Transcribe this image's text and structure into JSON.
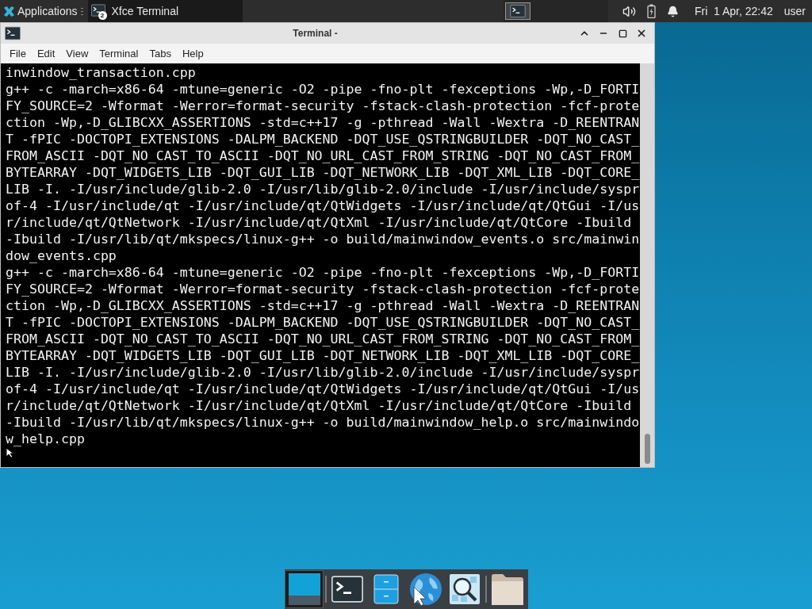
{
  "top_panel": {
    "applications_label": "Applications",
    "tasks": [
      {
        "title": "Xfce Terminal",
        "selected": true,
        "badge": "2"
      }
    ],
    "clock": "Fri  1 Apr, 22:42",
    "user": "user"
  },
  "window": {
    "title": "Terminal -",
    "menu": [
      "File",
      "Edit",
      "View",
      "Terminal",
      "Tabs",
      "Help"
    ],
    "lines": [
      "inwindow_transaction.cpp",
      "g++ -c -march=x86-64 -mtune=generic -O2 -pipe -fno-plt -fexceptions -Wp,-D_FORTI",
      "FY_SOURCE=2 -Wformat -Werror=format-security -fstack-clash-protection -fcf-prote",
      "ction -Wp,-D_GLIBCXX_ASSERTIONS -std=c++17 -g -pthread -Wall -Wextra -D_REENTRAN",
      "T -fPIC -DOCTOPI_EXTENSIONS -DALPM_BACKEND -DQT_USE_QSTRINGBUILDER -DQT_NO_CAST_",
      "FROM_ASCII -DQT_NO_CAST_TO_ASCII -DQT_NO_URL_CAST_FROM_STRING -DQT_NO_CAST_FROM_",
      "BYTEARRAY -DQT_WIDGETS_LIB -DQT_GUI_LIB -DQT_NETWORK_LIB -DQT_XML_LIB -DQT_CORE_",
      "LIB -I. -I/usr/include/glib-2.0 -I/usr/lib/glib-2.0/include -I/usr/include/syspr",
      "of-4 -I/usr/include/qt -I/usr/include/qt/QtWidgets -I/usr/include/qt/QtGui -I/us",
      "r/include/qt/QtNetwork -I/usr/include/qt/QtXml -I/usr/include/qt/QtCore -Ibuild",
      "-Ibuild -I/usr/lib/qt/mkspecs/linux-g++ -o build/mainwindow_events.o src/mainwin",
      "dow_events.cpp",
      "g++ -c -march=x86-64 -mtune=generic -O2 -pipe -fno-plt -fexceptions -Wp,-D_FORTI",
      "FY_SOURCE=2 -Wformat -Werror=format-security -fstack-clash-protection -fcf-prote",
      "ction -Wp,-D_GLIBCXX_ASSERTIONS -std=c++17 -g -pthread -Wall -Wextra -D_REENTRAN",
      "T -fPIC -DOCTOPI_EXTENSIONS -DALPM_BACKEND -DQT_USE_QSTRINGBUILDER -DQT_NO_CAST_",
      "FROM_ASCII -DQT_NO_CAST_TO_ASCII -DQT_NO_URL_CAST_FROM_STRING -DQT_NO_CAST_FROM_",
      "BYTEARRAY -DQT_WIDGETS_LIB -DQT_GUI_LIB -DQT_NETWORK_LIB -DQT_XML_LIB -DQT_CORE_",
      "LIB -I. -I/usr/include/glib-2.0 -I/usr/lib/glib-2.0/include -I/usr/include/syspr",
      "of-4 -I/usr/include/qt -I/usr/include/qt/QtWidgets -I/usr/include/qt/QtGui -I/us",
      "r/include/qt/QtNetwork -I/usr/include/qt/QtXml -I/usr/include/qt/QtCore -Ibuild",
      "-Ibuild -I/usr/lib/qt/mkspecs/linux-g++ -o build/mainwindow_help.o src/mainwindo",
      "w_help.cpp"
    ]
  },
  "dock": {
    "items": [
      {
        "kind": "desktop",
        "selected": true
      },
      {
        "kind": "terminal",
        "selected": false
      },
      {
        "kind": "files",
        "selected": false
      },
      {
        "kind": "browser",
        "selected": false
      },
      {
        "kind": "search",
        "selected": false
      },
      {
        "kind": "folder",
        "selected": false
      }
    ]
  }
}
